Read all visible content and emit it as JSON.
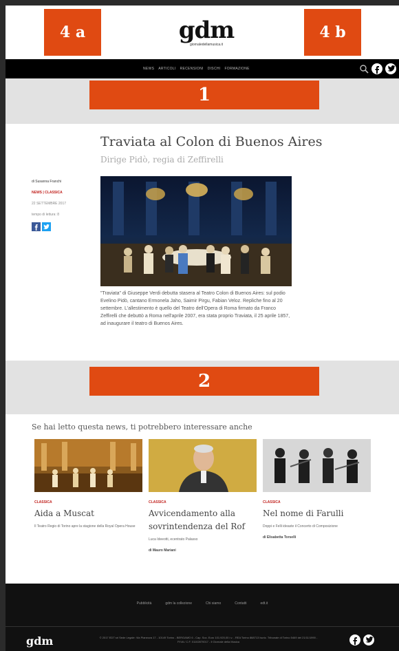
{
  "ads": {
    "top_left": "4 a",
    "top_right": "4 b",
    "band1": "1",
    "band2": "2"
  },
  "logo": {
    "name": "gdm",
    "tagline": "giornaledellamusica.it"
  },
  "nav": {
    "items": [
      "NEWS",
      "ARTICOLI",
      "RECENSIONI",
      "DISCHI",
      "FORMAZIONE"
    ],
    "icons": [
      "search-icon",
      "facebook-icon",
      "twitter-icon"
    ]
  },
  "article": {
    "title": "Traviata al Colon di Buenos Aires",
    "subtitle": "Dirige Pidò, regia di Zeffirelli",
    "author": "di Susanna Franchi",
    "categories": "NEWS | CLASSICA",
    "date": "22 SETTEMBRE 2017",
    "reading_time": "tempo di lettura: 8",
    "body": "\"Traviata\" di Giuseppe Verdi debutta stasera al Teatro Colon di Buenos Aires: sul podio Evelino Pidò, cantano Ermonela Jaho, Saimir Pirgu, Fabian Veloz. Repliche fino al 20 settembre. L'allestimento è quello del Teatro dell'Opera di Roma firmato da Franco Zeffirelli che debuttò a Roma nell'aprile 2007, era stata proprio Traviata, il 25 aprile 1857, ad inaugurare il teatro di Buenos Aires."
  },
  "related": {
    "heading": "Se hai letto questa news, ti potrebbero interessare anche",
    "cards": [
      {
        "category": "CLASSICA",
        "title": "Aida a Muscat",
        "summary": "Il Teatro Regio di Torino apre la stagione della Royal Opera House",
        "author": ""
      },
      {
        "category": "CLASSICA",
        "title": "Avvicendamento alla sovrintendenza del Rof",
        "summary": "Luca Ideeotti, ecentrato Palasso",
        "author": "di Mauro Mariani"
      },
      {
        "category": "CLASSICA",
        "title": "Nel nome di Farulli",
        "summary": "Doppi e Felli ideaste il Concerto di Composizione",
        "author": "di Elisabetta Torselli"
      }
    ]
  },
  "footer": {
    "links": [
      "Pubblicità",
      "gdm la collezione",
      "Chi siamo",
      "Contatti",
      "edt.it"
    ],
    "logo": "gdm",
    "copyright": "© 2017 EDT srl Sede Legale: Via Pianezza 17 - 10149 Torino - BERGAMO 6 - Cap. Soc. Euro 101.920,00 i.v. - REA Torino 868713 Iscriz. Tribunale di Torino 5469 del 21/11/1990 - P.IVA / C.F. 01102870017 - Il Giornale della Musica",
    "icons": [
      "facebook-icon",
      "twitter-icon"
    ]
  },
  "colors": {
    "accent": "#e04a12",
    "category_red": "#c0201c",
    "nav_bg": "#000000",
    "band_bg": "#e2e2e2",
    "footer_bg": "#111111"
  }
}
